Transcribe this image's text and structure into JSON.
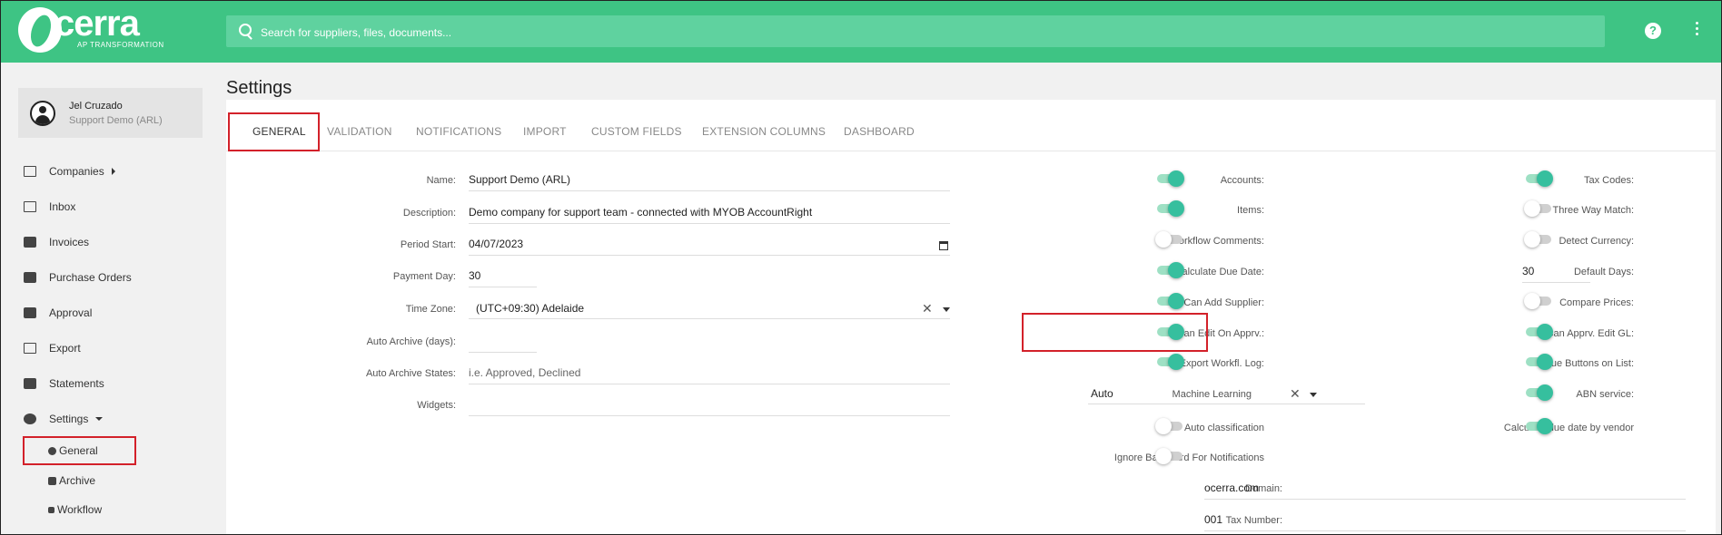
{
  "brand": {
    "name": "cerra",
    "tagline": "AP TRANSFORMATION"
  },
  "search": {
    "placeholder": "Search for suppliers, files, documents..."
  },
  "header": {
    "help_label": "?"
  },
  "user": {
    "name": "Jel Cruzado",
    "org": "Support Demo (ARL)"
  },
  "nav": {
    "companies": "Companies",
    "inbox": "Inbox",
    "invoices": "Invoices",
    "purchase_orders": "Purchase Orders",
    "approval": "Approval",
    "export": "Export",
    "statements": "Statements",
    "settings": "Settings",
    "sub": {
      "general": "General",
      "archive": "Archive",
      "workflow": "Workflow"
    }
  },
  "page": {
    "title": "Settings"
  },
  "tabs": [
    "GENERAL",
    "VALIDATION",
    "NOTIFICATIONS",
    "IMPORT",
    "CUSTOM FIELDS",
    "EXTENSION COLUMNS",
    "DASHBOARD"
  ],
  "form": {
    "name_label": "Name:",
    "name": "Support Demo (ARL)",
    "description_label": "Description:",
    "description": "Demo company for support team - connected with MYOB AccountRight",
    "period_start_label": "Period Start:",
    "period_start": "04/07/2023",
    "payment_day_label": "Payment Day:",
    "payment_day": "30",
    "time_zone_label": "Time Zone:",
    "time_zone": "(UTC+09:30) Adelaide",
    "auto_archive_days_label": "Auto Archive (days):",
    "auto_archive_days": "",
    "auto_archive_states_label": "Auto Archive States:",
    "auto_archive_states_placeholder": "i.e. Approved, Declined",
    "widgets_label": "Widgets:",
    "widgets": ""
  },
  "toggles_mid": [
    {
      "label": "Accounts:",
      "on": true
    },
    {
      "label": "Items:",
      "on": true
    },
    {
      "label": "Workflow Comments:",
      "on": false
    },
    {
      "label": "Calculate Due Date:",
      "on": true
    },
    {
      "label": "Can Add Supplier:",
      "on": true
    },
    {
      "label": "Can Edit On Apprv.:",
      "on": true
    },
    {
      "label": "Export Workfl. Log:",
      "on": true
    }
  ],
  "machine_learning": {
    "label": "Machine Learning",
    "value": "Auto"
  },
  "toggles_mid_lower": [
    {
      "label": "Auto classification",
      "on": false
    },
    {
      "label": "Ignore Backward For Notifications",
      "on": false
    }
  ],
  "domain": {
    "label": "Domain:",
    "value": "ocerra.com"
  },
  "tax_number": {
    "label": "Tax Number:",
    "value": "001"
  },
  "toggles_right": [
    {
      "label": "Tax Codes:",
      "on": true
    },
    {
      "label": "Three Way Match:",
      "on": false
    },
    {
      "label": "Detect Currency:",
      "on": false
    },
    {
      "label": "Default Days:",
      "value": "30"
    },
    {
      "label": "Compare Prices:",
      "on": false
    },
    {
      "label": "Can Apprv. Edit GL:",
      "on": true
    },
    {
      "label": "Due Buttons on List:",
      "on": true
    },
    {
      "label": "ABN service:",
      "on": true
    },
    {
      "label": "Calculate due date by vendor",
      "on": true
    }
  ],
  "colors": {
    "brand": "#3ec484",
    "toggle_on": "#36bf9e",
    "highlight": "#d3212a"
  }
}
